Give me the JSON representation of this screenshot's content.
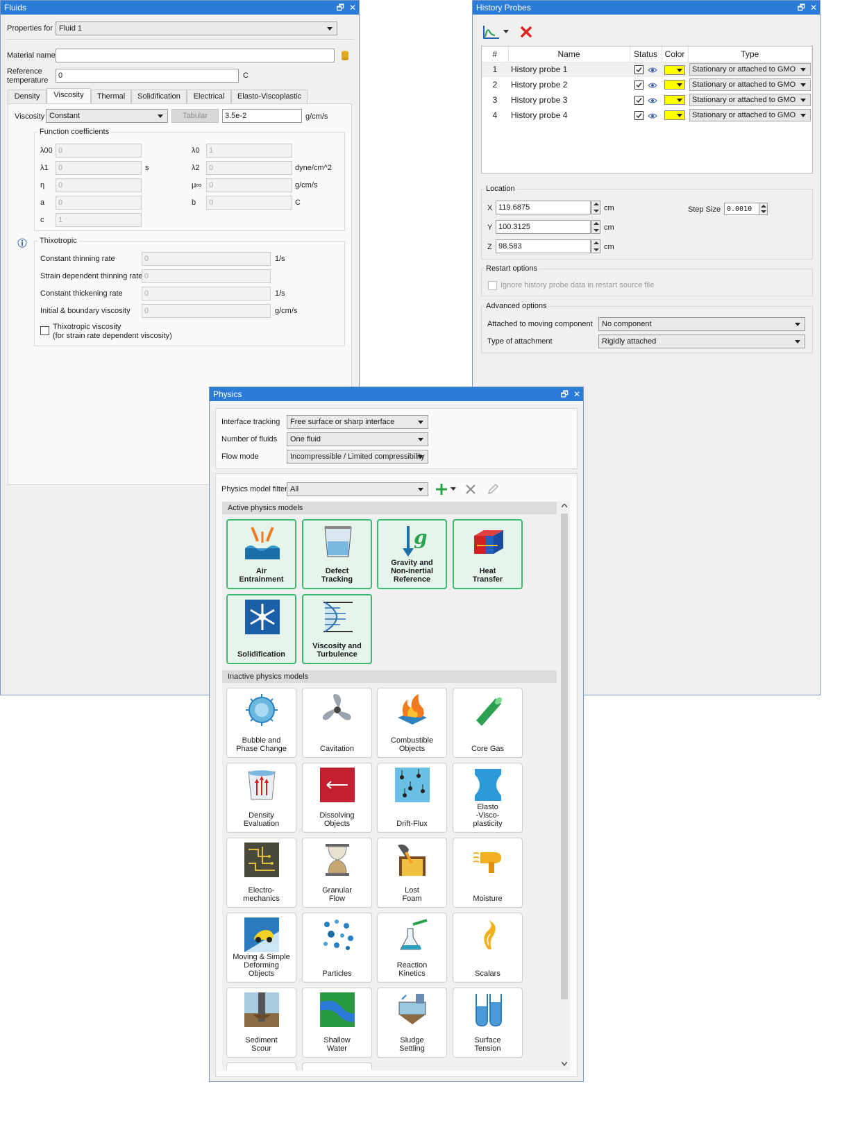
{
  "fluids": {
    "title": "Fluids",
    "properties_for_label": "Properties for",
    "properties_for_value": "Fluid 1",
    "material_name_label": "Material name",
    "material_name_value": "",
    "ref_temp_label_1": "Reference",
    "ref_temp_label_2": "temperature",
    "ref_temp_value": "0",
    "ref_temp_unit": "C",
    "tabs": [
      "Density",
      "Viscosity",
      "Thermal",
      "Solidification",
      "Electrical",
      "Elasto-Viscoplastic"
    ],
    "active_tab": "Viscosity",
    "viscosity_label": "Viscosity",
    "viscosity_mode": "Constant",
    "tabular_label": "Tabular",
    "viscosity_value": "3.5e-2",
    "viscosity_unit": "g/cm/s",
    "function_coefficients_title": "Function coefficients",
    "coefficients": [
      {
        "label": "λ00",
        "value": "0",
        "unit": ""
      },
      {
        "label": "λ0",
        "value": "1",
        "unit": ""
      },
      {
        "label": "λ1",
        "value": "0",
        "unit": "s"
      },
      {
        "label": "λ2",
        "value": "0",
        "unit": "dyne/cm^2"
      },
      {
        "label": "η",
        "value": "0",
        "unit": ""
      },
      {
        "label": "μ∞",
        "value": "0",
        "unit": "g/cm/s"
      },
      {
        "label": "a",
        "value": "0",
        "unit": ""
      },
      {
        "label": "b",
        "value": "0",
        "unit": "C"
      },
      {
        "label": "c",
        "value": "1",
        "unit": ""
      }
    ],
    "thixotropic_title": "Thixotropic",
    "thixo_rows": [
      {
        "label": "Constant thinning rate",
        "value": "0",
        "unit": "1/s"
      },
      {
        "label": "Strain dependent thinning rate",
        "value": "0",
        "unit": ""
      },
      {
        "label": "Constant thickening rate",
        "value": "0",
        "unit": "1/s"
      },
      {
        "label": "Initial & boundary viscosity",
        "value": "0",
        "unit": "g/cm/s"
      }
    ],
    "thixo_checkbox_line1": "Thixotropic viscosity",
    "thixo_checkbox_line2": "(for strain rate dependent viscosity)"
  },
  "history": {
    "title": "History Probes",
    "columns": [
      "#",
      "Name",
      "Status",
      "Color",
      "Type"
    ],
    "probes": [
      {
        "num": "1",
        "name": "History probe 1",
        "type": "Stationary or attached to GMO"
      },
      {
        "num": "2",
        "name": "History probe 2",
        "type": "Stationary or attached to GMO"
      },
      {
        "num": "3",
        "name": "History probe 3",
        "type": "Stationary or attached to GMO"
      },
      {
        "num": "4",
        "name": "History probe 4",
        "type": "Stationary or attached to GMO"
      }
    ],
    "probe_color": "#ffff00",
    "location_title": "Location",
    "x_label": "X",
    "x_value": "119.6875",
    "y_label": "Y",
    "y_value": "100.3125",
    "z_label": "Z",
    "z_value": "98.583",
    "unit": "cm",
    "step_size_label": "Step Size",
    "step_size_value": "0.0010",
    "restart_title": "Restart options",
    "restart_checkbox": "Ignore history probe data in restart source file",
    "advanced_title": "Advanced options",
    "attached_label": "Attached to moving component",
    "attached_value": "No component",
    "attach_type_label": "Type of attachment",
    "attach_type_value": "Rigidly attached"
  },
  "physics": {
    "title": "Physics",
    "interface_label": "Interface tracking",
    "interface_value": "Free surface or sharp interface",
    "fluids_label": "Number of fluids",
    "fluids_value": "One fluid",
    "flow_label": "Flow mode",
    "flow_value": "Incompressible / Limited compressibility",
    "filter_label": "Physics model filter",
    "filter_value": "All",
    "active_title": "Active physics models",
    "inactive_title": "Inactive physics models",
    "active_models": [
      {
        "l1": "Air",
        "l2": "Entrainment",
        "l3": "",
        "icon": "air-entrainment-icon"
      },
      {
        "l1": "Defect",
        "l2": "Tracking",
        "l3": "",
        "icon": "defect-tracking-icon"
      },
      {
        "l1": "Gravity and",
        "l2": "Non-inertial",
        "l3": "Reference",
        "icon": "gravity-icon"
      },
      {
        "l1": "Heat",
        "l2": "Transfer",
        "l3": "",
        "icon": "heat-transfer-icon"
      },
      {
        "l1": "Solidification",
        "l2": "",
        "l3": "",
        "icon": "solidification-icon"
      },
      {
        "l1": "Viscosity and",
        "l2": "Turbulence",
        "l3": "",
        "icon": "viscosity-turbulence-icon"
      }
    ],
    "inactive_models": [
      {
        "l1": "Bubble and",
        "l2": "Phase Change",
        "l3": "",
        "icon": "bubble-phase-change-icon"
      },
      {
        "l1": "Cavitation",
        "l2": "",
        "l3": "",
        "icon": "cavitation-icon"
      },
      {
        "l1": "Combustible",
        "l2": "Objects",
        "l3": "",
        "icon": "combustible-objects-icon"
      },
      {
        "l1": "Core Gas",
        "l2": "",
        "l3": "",
        "icon": "core-gas-icon"
      },
      {
        "l1": "Density",
        "l2": "Evaluation",
        "l3": "",
        "icon": "density-evaluation-icon"
      },
      {
        "l1": "Dissolving",
        "l2": "Objects",
        "l3": "",
        "icon": "dissolving-objects-icon"
      },
      {
        "l1": "Drift-Flux",
        "l2": "",
        "l3": "",
        "icon": "drift-flux-icon"
      },
      {
        "l1": "Elasto",
        "l2": "-Visco-",
        "l3": "plasticity",
        "icon": "elasto-visco-plasticity-icon"
      },
      {
        "l1": "Electro-",
        "l2": "mechanics",
        "l3": "",
        "icon": "electro-mechanics-icon"
      },
      {
        "l1": "Granular",
        "l2": "Flow",
        "l3": "",
        "icon": "granular-flow-icon"
      },
      {
        "l1": "Lost",
        "l2": "Foam",
        "l3": "",
        "icon": "lost-foam-icon"
      },
      {
        "l1": "Moisture",
        "l2": "",
        "l3": "",
        "icon": "moisture-icon"
      },
      {
        "l1": "Moving & Simple",
        "l2": "Deforming",
        "l3": "Objects",
        "icon": "moving-objects-icon"
      },
      {
        "l1": "Particles",
        "l2": "",
        "l3": "",
        "icon": "particles-icon"
      },
      {
        "l1": "Reaction",
        "l2": "Kinetics",
        "l3": "",
        "icon": "reaction-kinetics-icon"
      },
      {
        "l1": "Scalars",
        "l2": "",
        "l3": "",
        "icon": "scalars-icon"
      },
      {
        "l1": "Sediment",
        "l2": "Scour",
        "l3": "",
        "icon": "sediment-scour-icon"
      },
      {
        "l1": "Shallow",
        "l2": "Water",
        "l3": "",
        "icon": "shallow-water-icon"
      },
      {
        "l1": "Sludge",
        "l2": "Settling",
        "l3": "",
        "icon": "sludge-settling-icon"
      },
      {
        "l1": "Surface",
        "l2": "Tension",
        "l3": "",
        "icon": "surface-tension-icon"
      }
    ]
  }
}
